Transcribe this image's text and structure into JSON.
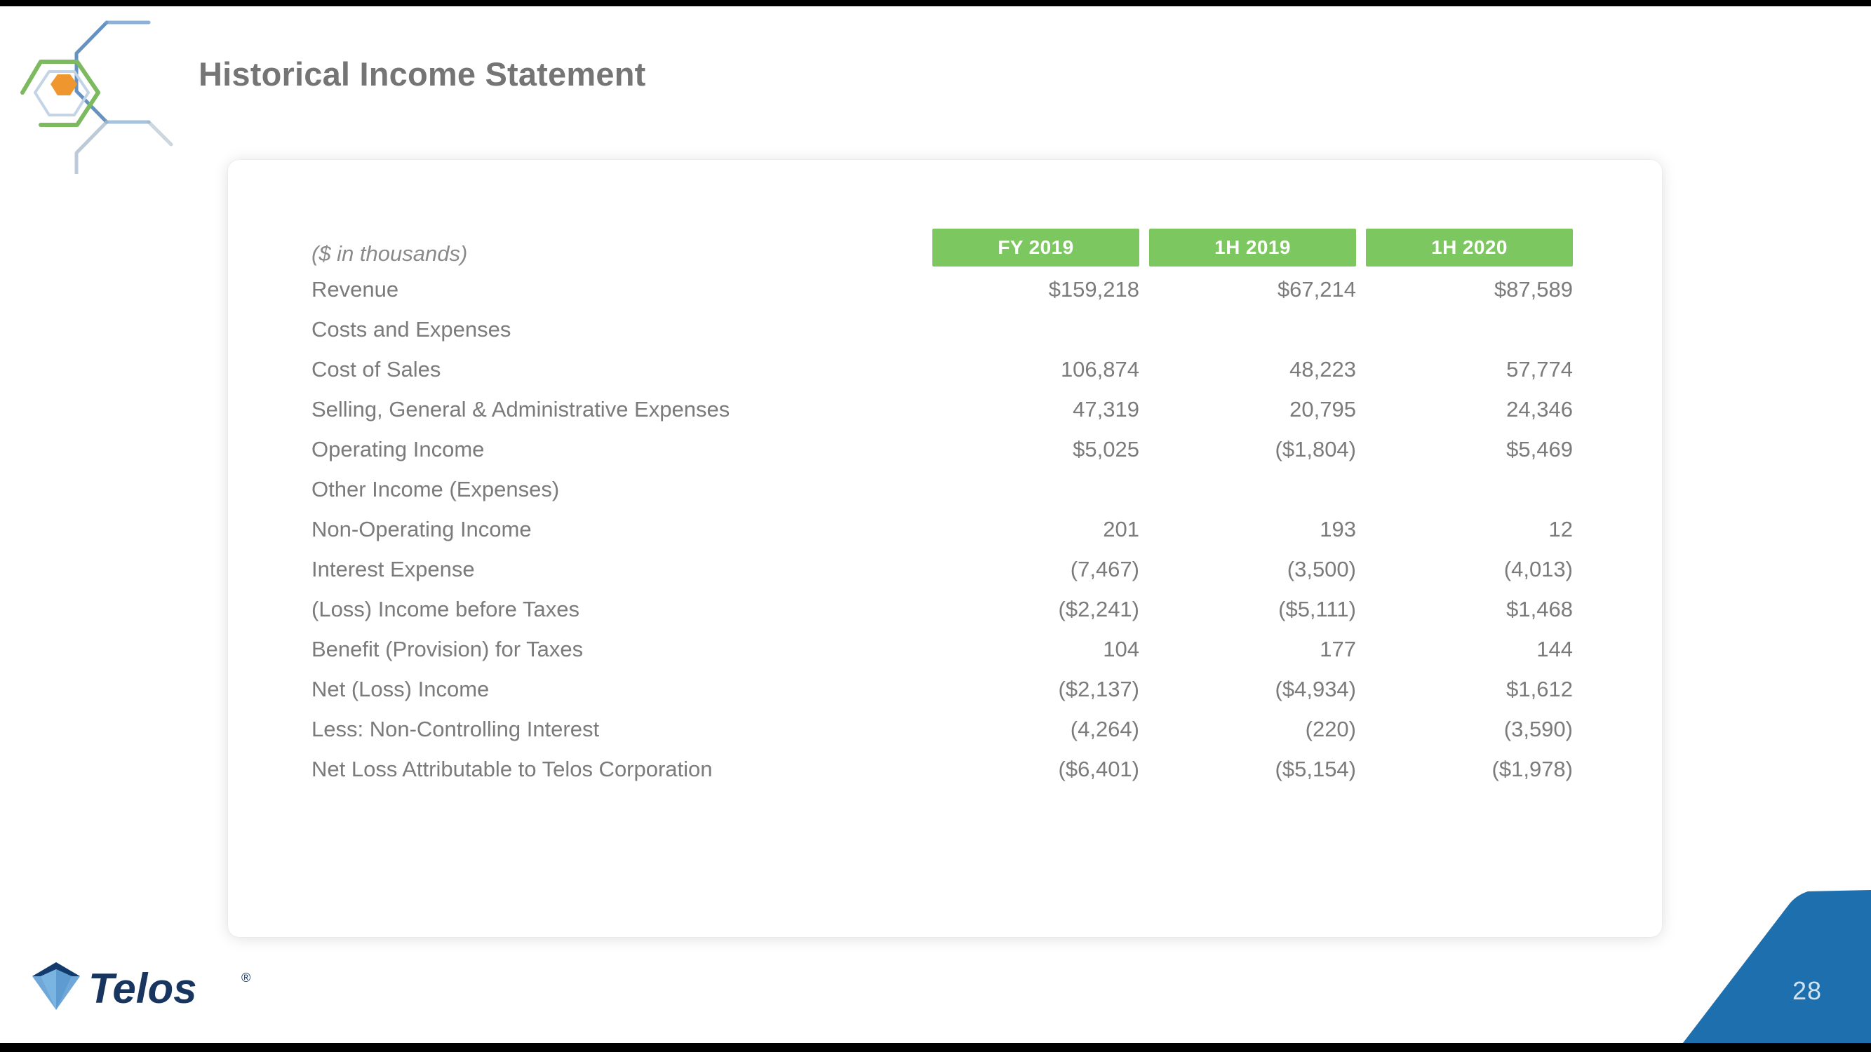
{
  "slide": {
    "title": "Historical Income Statement",
    "page_number": "28",
    "brand_name": "Telos",
    "accent_green": "#7cc75f",
    "accent_blue": "#1e6fad",
    "text_gray": "#7b7b7b",
    "title_gray": "#757575",
    "logo_orange": "#f0962e"
  },
  "table": {
    "units_label": "($ in thousands)",
    "columns": [
      {
        "label": "FY 2019"
      },
      {
        "label": "1H 2019"
      },
      {
        "label": "1H 2020"
      }
    ],
    "rows": [
      {
        "label": "Revenue",
        "indent": 0,
        "values": [
          "$159,218",
          "$67,214",
          "$87,589"
        ]
      },
      {
        "label": "Costs and Expenses",
        "indent": 0,
        "values": [
          "",
          "",
          ""
        ]
      },
      {
        "label": "Cost of Sales",
        "indent": 1,
        "values": [
          "106,874",
          "48,223",
          "57,774"
        ]
      },
      {
        "label": "Selling, General & Administrative Expenses",
        "indent": 1,
        "values": [
          "47,319",
          "20,795",
          "24,346"
        ]
      },
      {
        "label": "Operating Income",
        "indent": 0,
        "values": [
          "$5,025",
          "($1,804)",
          "$5,469"
        ]
      },
      {
        "label": "Other Income (Expenses)",
        "indent": 0,
        "values": [
          "",
          "",
          ""
        ]
      },
      {
        "label": "Non-Operating Income",
        "indent": 1,
        "values": [
          "201",
          "193",
          "12"
        ]
      },
      {
        "label": "Interest Expense",
        "indent": 1,
        "values": [
          "(7,467)",
          "(3,500)",
          "(4,013)"
        ]
      },
      {
        "label": "(Loss) Income before Taxes",
        "indent": 0,
        "values": [
          "($2,241)",
          "($5,111)",
          "$1,468"
        ]
      },
      {
        "label": "Benefit (Provision) for Taxes",
        "indent": 1,
        "values": [
          "104",
          "177",
          "144"
        ]
      },
      {
        "label": "Net (Loss) Income",
        "indent": 0,
        "values": [
          "($2,137)",
          "($4,934)",
          "$1,612"
        ]
      },
      {
        "label": "Less: Non-Controlling Interest",
        "indent": 1,
        "values": [
          "(4,264)",
          "(220)",
          "(3,590)"
        ]
      },
      {
        "label": "Net Loss Attributable to Telos Corporation",
        "indent": 0,
        "values": [
          "($6,401)",
          "($5,154)",
          "($1,978)"
        ]
      }
    ]
  },
  "icons": {
    "hex_logo": "hexagon-network-logo-icon",
    "telos_mark": "diamond-gem-icon"
  }
}
